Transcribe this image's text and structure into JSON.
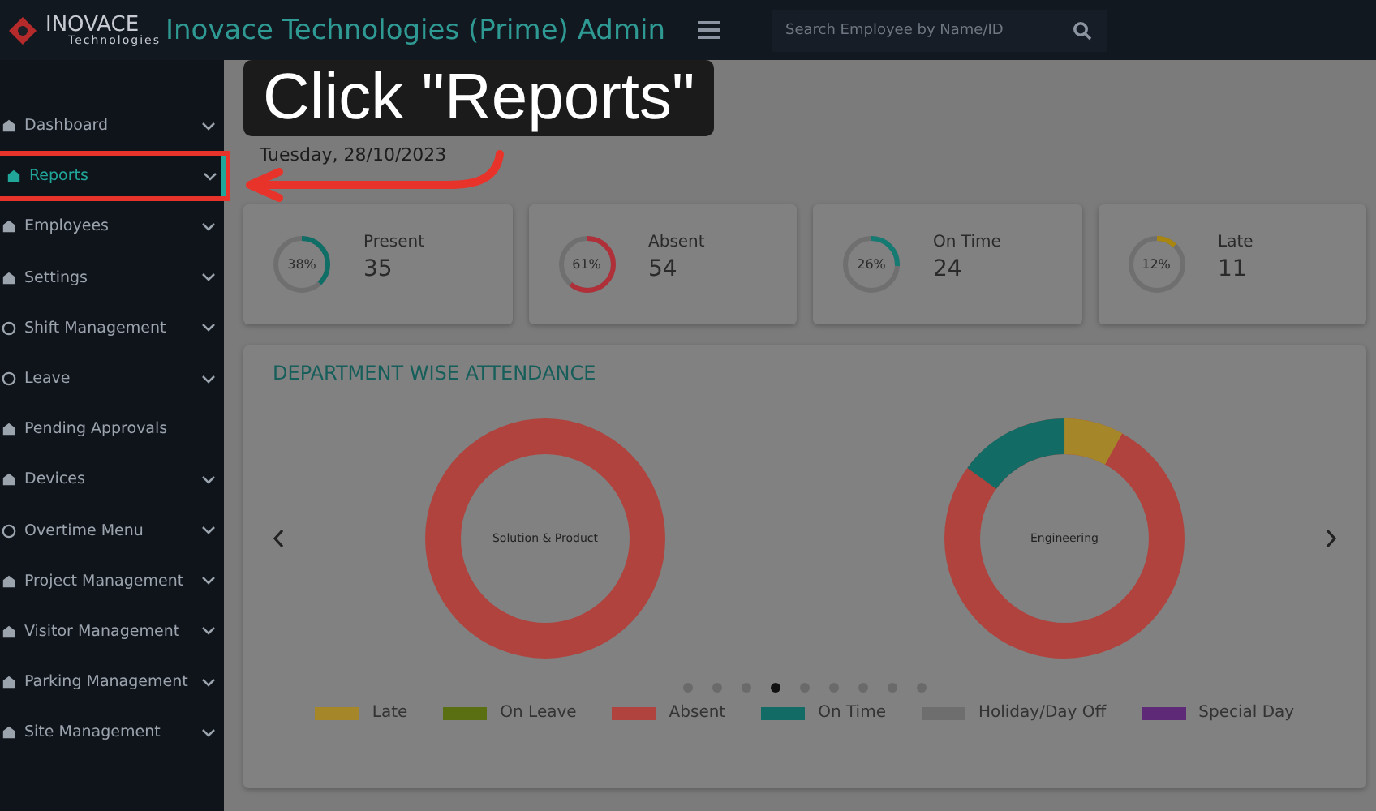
{
  "brand": {
    "name": "INOVACE",
    "tagline": "Technologies"
  },
  "app_title": "Inovace Technologies (Prime) Admin",
  "search": {
    "placeholder": "Search Employee by Name/ID"
  },
  "caption": "Click \"Reports\"",
  "sidebar": {
    "items": [
      {
        "label": "Dashboard",
        "selected": false,
        "expandable": true
      },
      {
        "label": "Reports",
        "selected": true,
        "expandable": true
      },
      {
        "label": "Employees",
        "selected": false,
        "expandable": true
      },
      {
        "label": "Settings",
        "selected": false,
        "expandable": true
      },
      {
        "label": "Shift Management",
        "selected": false,
        "expandable": true
      },
      {
        "label": "Leave",
        "selected": false,
        "expandable": true
      },
      {
        "label": "Pending Approvals",
        "selected": false,
        "expandable": false
      },
      {
        "label": "Devices",
        "selected": false,
        "expandable": true
      },
      {
        "label": "Overtime Menu",
        "selected": false,
        "expandable": true
      },
      {
        "label": "Project Management",
        "selected": false,
        "expandable": true
      },
      {
        "label": "Visitor Management",
        "selected": false,
        "expandable": true
      },
      {
        "label": "Parking Management",
        "selected": false,
        "expandable": true
      },
      {
        "label": "Site Management",
        "selected": false,
        "expandable": true
      }
    ]
  },
  "date": "Tuesday, 28/10/2023",
  "stats": [
    {
      "label": "Present",
      "value": "35",
      "percent": "38%",
      "level": 0.38,
      "color": "#0f6e66"
    },
    {
      "label": "Absent",
      "value": "54",
      "percent": "61%",
      "level": 0.61,
      "color": "#b0303a"
    },
    {
      "label": "On Time",
      "value": "24",
      "percent": "26%",
      "level": 0.26,
      "color": "#147a72"
    },
    {
      "label": "Late",
      "value": "11",
      "percent": "12%",
      "level": 0.12,
      "color": "#a8860f"
    }
  ],
  "department_panel": {
    "title": "DEPARTMENT WISE ATTENDANCE",
    "charts": [
      {
        "label": "Solution & Product"
      },
      {
        "label": "Engineering"
      }
    ],
    "dots": [
      {
        "selected": false
      },
      {
        "selected": false
      },
      {
        "selected": false
      },
      {
        "selected": true
      },
      {
        "selected": false
      },
      {
        "selected": false
      },
      {
        "selected": false
      },
      {
        "selected": false
      },
      {
        "selected": false
      }
    ],
    "legend": [
      {
        "label": "Late",
        "color": "#a5872a"
      },
      {
        "label": "On Leave",
        "color": "#5a6e12"
      },
      {
        "label": "Absent",
        "color": "#b0433d"
      },
      {
        "label": "On Time",
        "color": "#136b66"
      },
      {
        "label": "Holiday/Day Off",
        "color": "#6e6e6e"
      },
      {
        "label": "Special Day",
        "color": "#5e2a78"
      }
    ]
  }
}
